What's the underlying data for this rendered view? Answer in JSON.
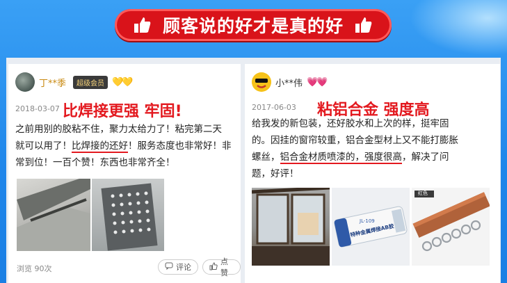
{
  "banner": {
    "title": "顾客说的好才是真的好"
  },
  "reviews": [
    {
      "user": "丁**季",
      "badge": "超级会员",
      "gem": "💛💛",
      "date": "2018-03-07",
      "headline": "比焊接更强  牢固!",
      "lines": [
        "之前用别的胶粘不住，聚力太给力了！粘完第二天",
        "就可以用了！",
        "比焊接的还好",
        "！服务态度也非常好！非",
        "常到位！一百个赞！东西也非常齐全！"
      ],
      "views": "浏览 90次",
      "comment_label": "评论",
      "like_label": "点赞"
    },
    {
      "user": "小**伟",
      "hearts": "💗💗",
      "date": "2017-06-03",
      "headline": "粘铝合金  强度高",
      "lines": [
        "给我发的新包装，还好胶水和上次的样，挺牢固",
        "的。因挂的窗帘较重，铝合金型材上又不能打膨胀",
        "螺丝，",
        "铝合金材质喷漆的，强度很高",
        "，解决了问",
        "题，好评！"
      ],
      "product_label": "特种金属焊接AB胶",
      "product_code": "JL-109",
      "photo_tag": "红色"
    }
  ]
}
